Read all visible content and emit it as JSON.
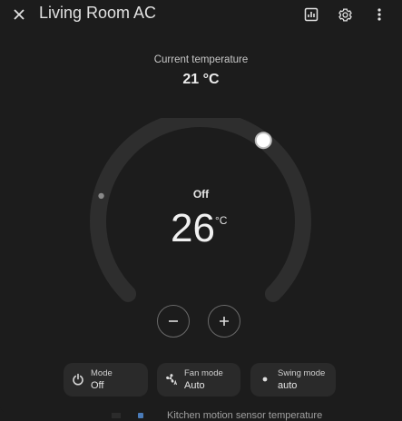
{
  "header": {
    "title": "Living Room AC",
    "close_icon": "close-icon",
    "history_icon": "chart-box-icon",
    "settings_icon": "gear-icon",
    "menu_icon": "dots-vertical-icon"
  },
  "current": {
    "label": "Current temperature",
    "value": "21 °C"
  },
  "dial": {
    "state": "Off",
    "target": "26",
    "unit": "°C",
    "setpoint_fraction": 0.64,
    "min_marker_fraction": 0.22,
    "track_color": "#2e2e2e",
    "handle_color": "#ffffff"
  },
  "controls": {
    "decrease_icon": "minus-icon",
    "increase_icon": "plus-icon"
  },
  "features": [
    {
      "label": "Mode",
      "value": "Off",
      "icon": "power-icon"
    },
    {
      "label": "Fan mode",
      "value": "Auto",
      "icon": "fan-auto-icon"
    },
    {
      "label": "Swing mode",
      "value": "auto",
      "icon": "dot-icon"
    }
  ],
  "background": {
    "text": "Kitchen motion sensor temperature"
  }
}
